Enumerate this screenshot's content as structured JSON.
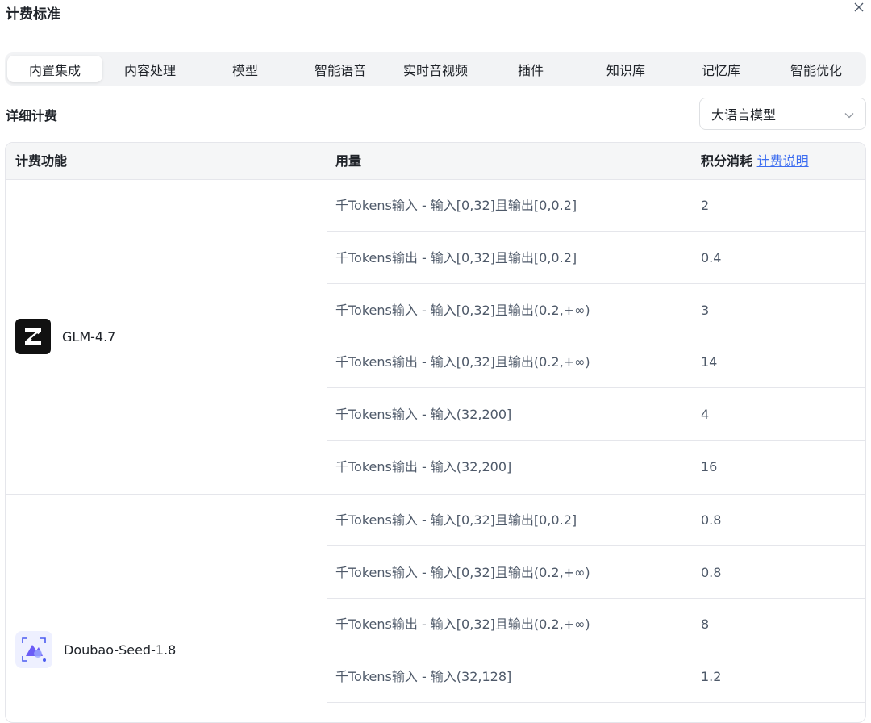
{
  "dialog": {
    "title": "计费标准"
  },
  "tabs": [
    {
      "label": "内置集成",
      "active": true
    },
    {
      "label": "内容处理"
    },
    {
      "label": "模型"
    },
    {
      "label": "智能语音"
    },
    {
      "label": "实时音视频"
    },
    {
      "label": "插件"
    },
    {
      "label": "知识库"
    },
    {
      "label": "记忆库"
    },
    {
      "label": "智能优化"
    }
  ],
  "section": {
    "title": "详细计费"
  },
  "select": {
    "value": "大语言模型"
  },
  "table": {
    "headers": {
      "feature": "计费功能",
      "usage": "用量",
      "credits": "积分消耗",
      "credits_link": "计费说明"
    },
    "groups": [
      {
        "name": "GLM-4.7",
        "logo": "glm-z-logo",
        "rows": [
          {
            "usage": "千Tokens输入 - 输入[0,32]且输出[0,0.2]",
            "credits": "2"
          },
          {
            "usage": "千Tokens输出 - 输入[0,32]且输出[0,0.2]",
            "credits": "0.4"
          },
          {
            "usage": "千Tokens输入 - 输入[0,32]且输出(0.2,+∞)",
            "credits": "3"
          },
          {
            "usage": "千Tokens输出 - 输入[0,32]且输出(0.2,+∞)",
            "credits": "14"
          },
          {
            "usage": "千Tokens输入 - 输入(32,200]",
            "credits": "4"
          },
          {
            "usage": "千Tokens输出 - 输入(32,200]",
            "credits": "16"
          }
        ]
      },
      {
        "name": "Doubao-Seed-1.8",
        "logo": "doubao-logo",
        "rows": [
          {
            "usage": "千Tokens输入 - 输入[0,32]且输出[0,0.2]",
            "credits": "0.8"
          },
          {
            "usage": "千Tokens输入 - 输入[0,32]且输出(0.2,+∞)",
            "credits": "0.8"
          },
          {
            "usage": "千Tokens输出 - 输入[0,32]且输出(0.2,+∞)",
            "credits": "8"
          },
          {
            "usage": "千Tokens输入 - 输入(32,128]",
            "credits": "1.2"
          }
        ]
      }
    ]
  },
  "colors": {
    "link": "#3c6df0",
    "border": "#e5e6eb",
    "header_bg": "#f5f6f7",
    "tab_bg": "#f2f3f5"
  }
}
